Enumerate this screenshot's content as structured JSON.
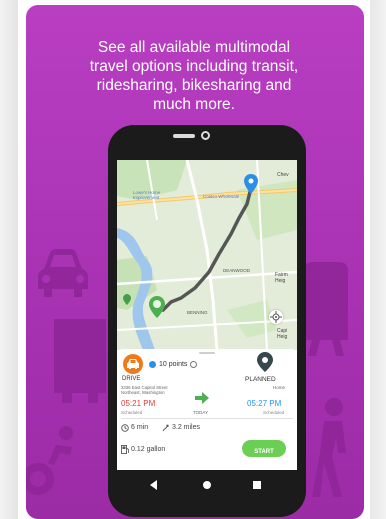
{
  "headline": {
    "line1": "See all available multimodal",
    "line2": "travel options including transit,",
    "line3": "ridesharing, bikesharing and",
    "line4": "much more."
  },
  "map": {
    "labels": {
      "cheverly": "Chev",
      "lowes": "Lowe's Home Improvement",
      "costco": "Costco Wholesale",
      "deanwood": "DEANWOOD",
      "benning": "BENNING",
      "fairmount": "Fairm Heig",
      "capitol": "Capi Heig"
    }
  },
  "trip": {
    "mode_label": "DRIVE",
    "points": "10 points",
    "status_label": "PLANNED",
    "origin_address": "3336 East Capitol Street Northeast, Washington",
    "destination": "Home",
    "depart_time": "05:21 PM",
    "depart_note": "Scheduled",
    "day_label": "TODAY",
    "arrive_time": "05:27 PM",
    "arrive_note": "Scheduled",
    "duration": "6 min",
    "distance": "3.2 miles",
    "fuel": "0.12 gallon",
    "start_label": "START"
  },
  "colors": {
    "background": "#a832b3",
    "drive_orange": "#f07a1a",
    "depart_red": "#e53935",
    "arrive_blue": "#2196f3",
    "start_green": "#6ccf55",
    "arrow_green": "#4caf50"
  }
}
